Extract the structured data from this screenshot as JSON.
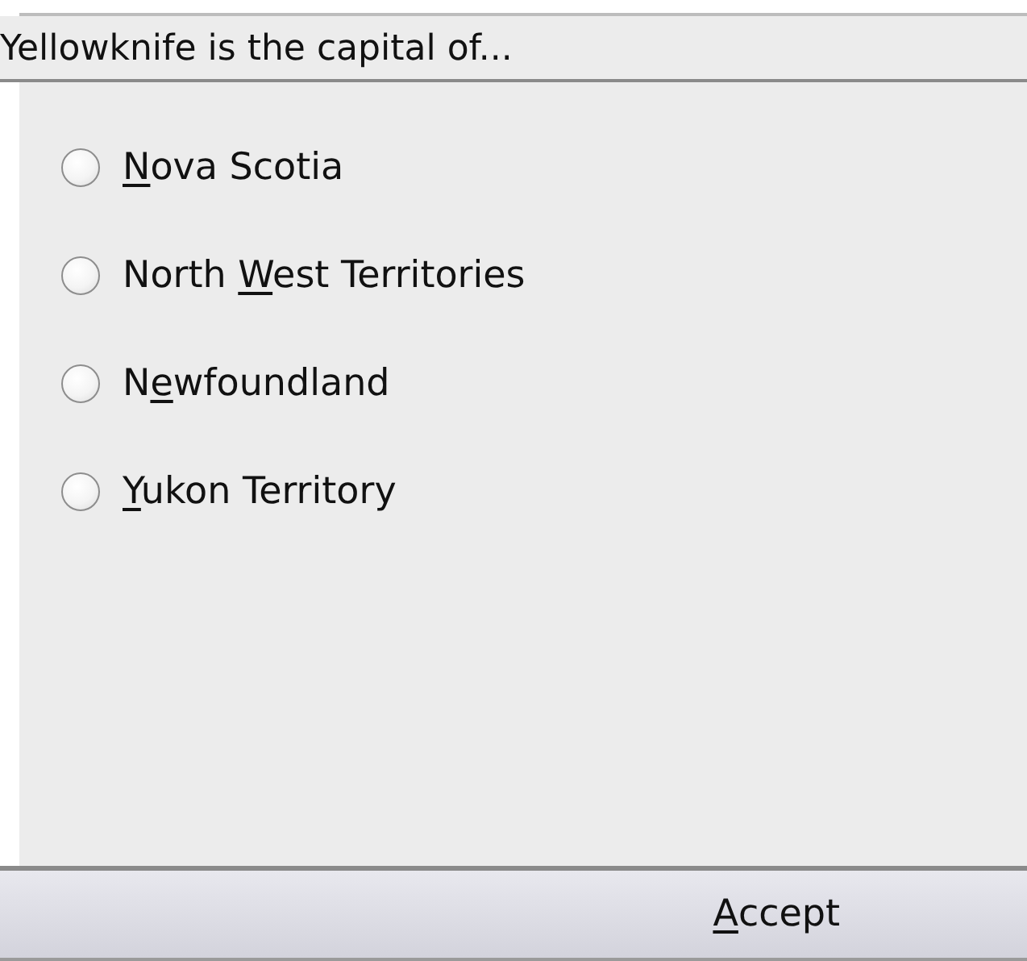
{
  "question": "Yellowknife is the capital of...",
  "options": [
    {
      "key": "N",
      "suffix": "ova Scotia",
      "selected": false
    },
    {
      "prefix": "North ",
      "key": "W",
      "suffix": "est Territories",
      "selected": false
    },
    {
      "prefix": "N",
      "key": "e",
      "suffix": "wfoundland",
      "selected": false
    },
    {
      "key": "Y",
      "suffix": "ukon Territory",
      "selected": false
    }
  ],
  "accept_button": {
    "key": "A",
    "suffix": "ccept"
  }
}
